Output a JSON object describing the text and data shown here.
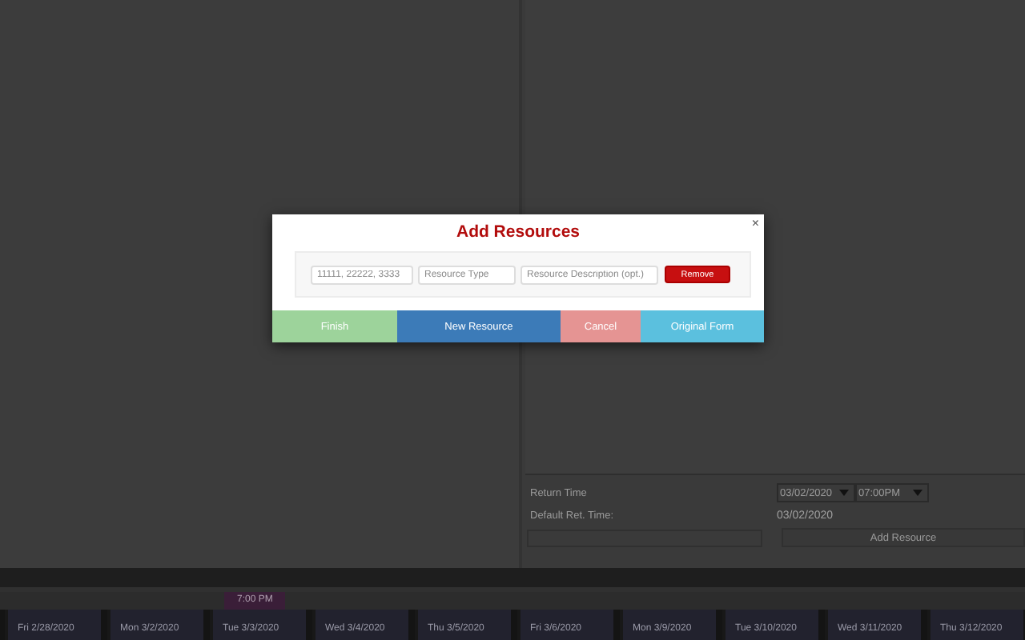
{
  "modal": {
    "title": "Add Resources",
    "close": "×",
    "resource_row": {
      "ids_placeholder": "11111, 22222, 3333",
      "type_placeholder": "Resource Type",
      "description_placeholder": "Resource Description (opt.)",
      "remove": "Remove"
    },
    "buttons": [
      {
        "label": "Finish",
        "kind": "finish"
      },
      {
        "label": "New Resource",
        "kind": "new"
      },
      {
        "label": "Cancel",
        "kind": "cancel"
      },
      {
        "label": "Original Form",
        "kind": "original"
      }
    ]
  },
  "background_form": {
    "return_time_label": "Return Time",
    "return_date": "03/02/2020",
    "return_time": "07:00PM",
    "default_return_label": "Default Ret. Time:",
    "default_return_value": "03/02/2020",
    "add_resource": "Add Resource"
  },
  "timeline": {
    "marker": "7:00 PM",
    "days": [
      "Fri 2/28/2020",
      "Mon 3/2/2020",
      "Tue 3/3/2020",
      "Wed 3/4/2020",
      "Thu 3/5/2020",
      "Fri 3/6/2020",
      "Mon 3/9/2020",
      "Tue 3/10/2020",
      "Wed 3/11/2020",
      "Thu 3/12/2020"
    ]
  }
}
